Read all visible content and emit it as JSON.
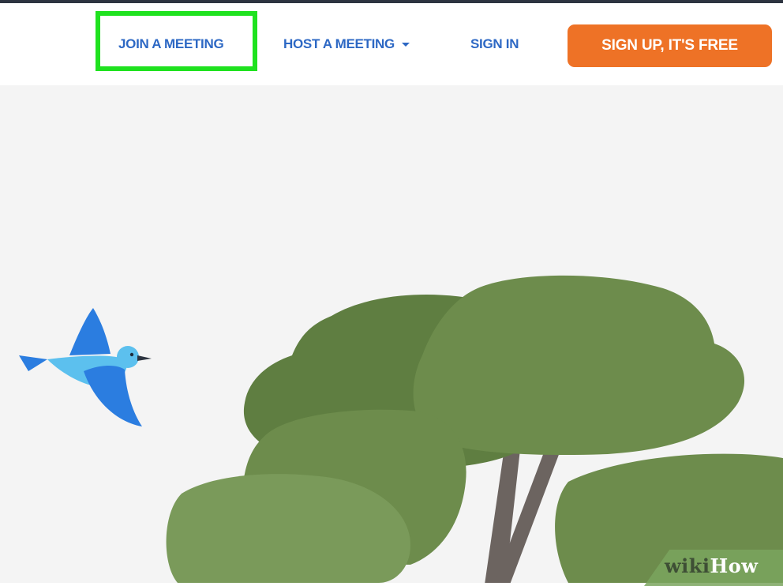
{
  "nav": {
    "join_label": "JOIN A MEETING",
    "host_label": "HOST A MEETING",
    "host_dropdown_icon": "caret-down-icon",
    "signin_label": "SIGN IN",
    "signup_label": "SIGN UP, IT'S FREE"
  },
  "hero": {
    "illustration": [
      "bird",
      "trees"
    ]
  },
  "watermark": {
    "part1": "wiki",
    "part2": "How"
  },
  "colors": {
    "nav_link": "#2d68c4",
    "signup_button": "#ee7226",
    "highlight": "#1fe21f",
    "hero_background": "#f4f4f4",
    "tree_dark": "#5f7e41",
    "tree_light": "#6d8c4c",
    "trunk": "#6c6460",
    "bird_blue": "#2b7de0",
    "bird_light": "#5cc0ee"
  }
}
